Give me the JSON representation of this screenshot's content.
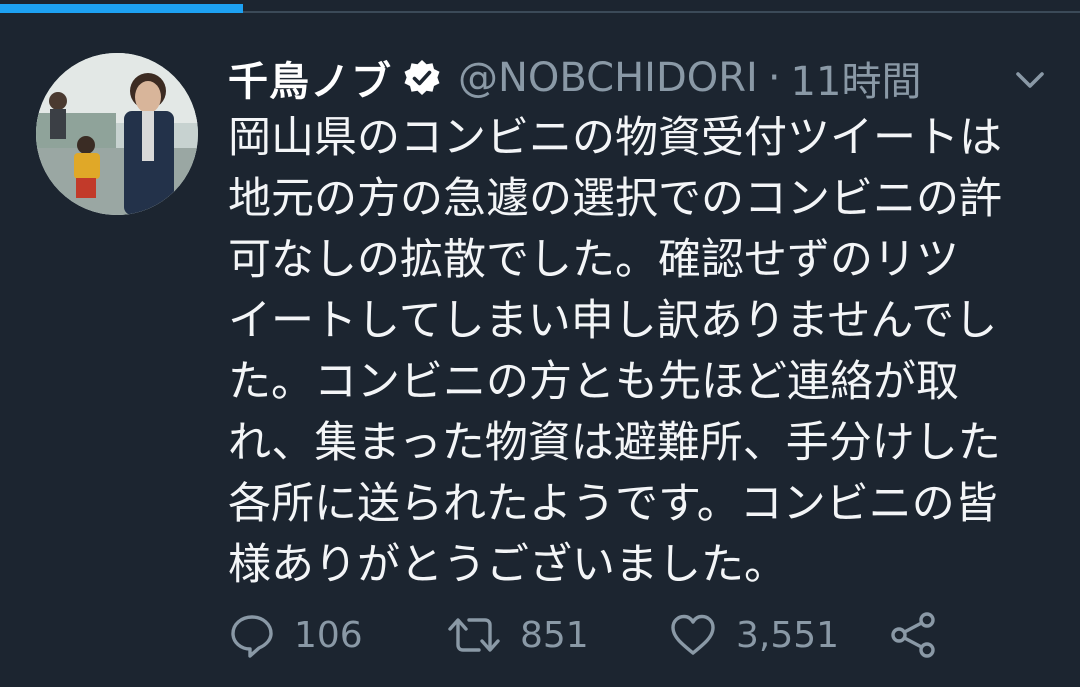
{
  "video": {
    "progress": 0.225
  },
  "tweet": {
    "display_name": "千鳥ノブ",
    "verified": true,
    "handle": "@NOBCHIDORI",
    "separator": "·",
    "time_ago": "11時間",
    "text_lines": [
      "岡山県のコンビニの物資受付ツイートは",
      "地元の方の急遽の選択でのコンビニの許",
      "可なしの拡散でした。確認せずのリツ",
      "イートしてしまい申し訳ありませんでし",
      "た。コンビニの方とも先ほど連絡が取",
      "れ、集まった物資は避難所、手分けした",
      "各所に送られたようです。コンビニの皆",
      "様ありがとうございました。"
    ],
    "actions": {
      "reply_count": "106",
      "retweet_count": "851",
      "like_count": "3,551"
    }
  },
  "icons": {
    "verified": "verified-badge-icon",
    "caret": "chevron-down-icon",
    "reply": "reply-icon",
    "retweet": "retweet-icon",
    "like": "heart-icon",
    "share": "share-icon"
  },
  "colors": {
    "background": "#1c2530",
    "accent": "#1da1f2",
    "muted": "#8a99a6",
    "text": "#f3f5f7"
  }
}
